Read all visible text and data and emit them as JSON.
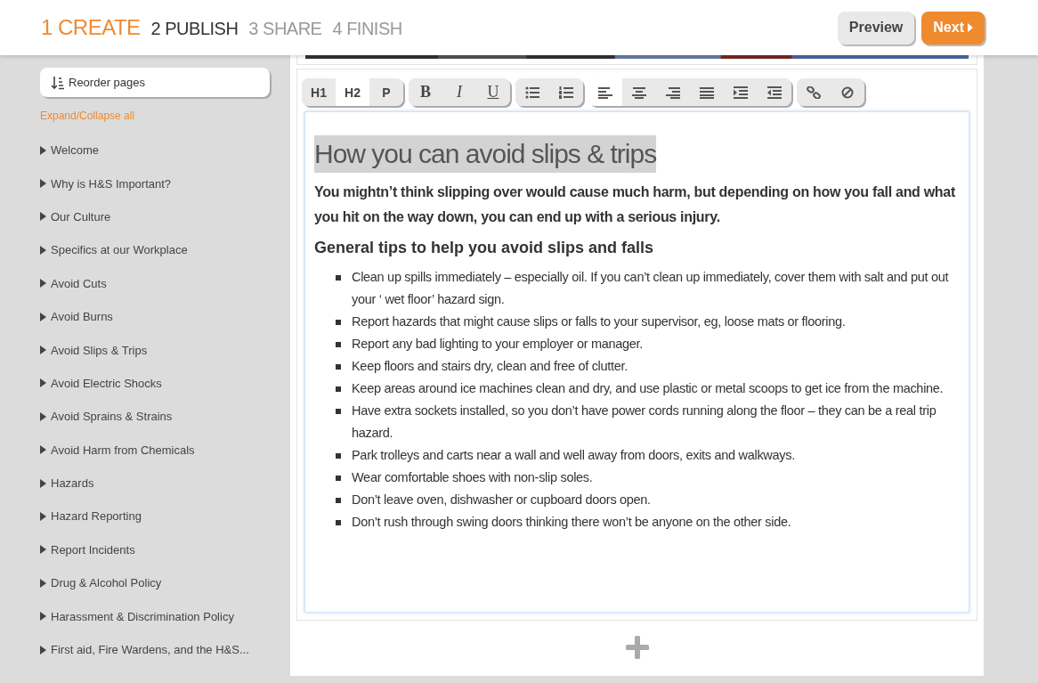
{
  "steps": [
    {
      "number": "1",
      "label": "CREATE",
      "selected": true,
      "disabled": false
    },
    {
      "number": "2",
      "label": "PUBLISH",
      "selected": false,
      "disabled": false
    },
    {
      "number": "3",
      "label": "SHARE",
      "selected": false,
      "disabled": true
    },
    {
      "number": "4",
      "label": "FINISH",
      "selected": false,
      "disabled": true
    }
  ],
  "header_buttons": [
    {
      "label": "Preview",
      "kind": "secondary"
    },
    {
      "label": "Next",
      "kind": "primary"
    }
  ],
  "sidebar": {
    "reorder_button": "Reorder pages",
    "expand_link": "Expand/Collapse all",
    "items": [
      {
        "label": "Welcome",
        "expanded": false
      },
      {
        "label": "Why is H&S Important?",
        "expanded": false
      },
      {
        "label": "Our Culture",
        "expanded": false
      },
      {
        "label": "Specifics at our Workplace",
        "expanded": false
      },
      {
        "label": "Avoid Cuts",
        "expanded": false
      },
      {
        "label": "Avoid Burns",
        "expanded": false
      },
      {
        "label": "Avoid Slips & Trips",
        "expanded": false
      },
      {
        "label": "Avoid Electric Shocks",
        "expanded": false
      },
      {
        "label": "Avoid Sprains & Strains",
        "expanded": false
      },
      {
        "label": "Avoid Harm from Chemicals",
        "expanded": false
      },
      {
        "label": "Hazards",
        "expanded": false
      },
      {
        "label": "Hazard Reporting",
        "expanded": false
      },
      {
        "label": "Report Incidents",
        "expanded": false
      },
      {
        "label": "Drug & Alcohol Policy",
        "expanded": false
      },
      {
        "label": "Harassment & Discrimination Policy",
        "expanded": false
      },
      {
        "label": "First aid, Fire Wardens, and the H&S...",
        "expanded": false
      }
    ]
  },
  "toolbar": [
    [
      {
        "kind": "text",
        "label": "H1",
        "selected": false
      },
      {
        "kind": "text",
        "label": "H2",
        "selected": true
      },
      {
        "kind": "text",
        "label": "P",
        "selected": false
      }
    ],
    [
      {
        "kind": "bold",
        "label": "B",
        "selected": false
      },
      {
        "kind": "italic",
        "label": "I",
        "selected": false
      },
      {
        "kind": "underline",
        "label": "U",
        "selected": false
      }
    ],
    [
      {
        "kind": "icon",
        "selected": false
      },
      {
        "kind": "icon",
        "selected": false
      }
    ],
    [
      {
        "kind": "icon",
        "selected": true
      },
      {
        "kind": "icon",
        "selected": false
      },
      {
        "kind": "icon",
        "selected": false
      },
      {
        "kind": "icon",
        "selected": false
      },
      {
        "kind": "icon",
        "selected": false
      },
      {
        "kind": "icon",
        "selected": false
      }
    ],
    [
      {
        "kind": "icon",
        "selected": false
      },
      {
        "kind": "icon",
        "selected": false
      }
    ]
  ],
  "editor": {
    "heading": "How you can avoid slips & trips",
    "heading_selected": true,
    "intro": "You mightn’t think slipping over would cause much harm, but depending on how you fall and what you hit on the way down, you can end up with a serious injury.",
    "subheading": "General tips to help you avoid slips and falls",
    "tips": [
      "Clean up spills immediately – especially oil. If you can’t clean up immediately, cover them with salt and put out your ‘ wet floor’ hazard sign.",
      "Report hazards that might cause slips or falls to your supervisor, eg, loose mats or flooring.",
      "Report any bad lighting to your employer or manager.",
      "Keep floors and stairs dry, clean and free of clutter.",
      "Keep areas around ice machines clean and dry, and use plastic or metal scoops to get ice from the machine.",
      "Have extra sockets installed, so you don’t have power cords running along the floor – they can be a real trip hazard.",
      "Park trolleys and carts near a wall and well away from doors, exits and walkways.",
      "Wear comfortable shoes with non-slip soles.",
      "Don’t leave oven, dishwasher or cupboard doors open.",
      "Don’t rush through swing doors thinking there won’t be anyone on the other side."
    ]
  }
}
